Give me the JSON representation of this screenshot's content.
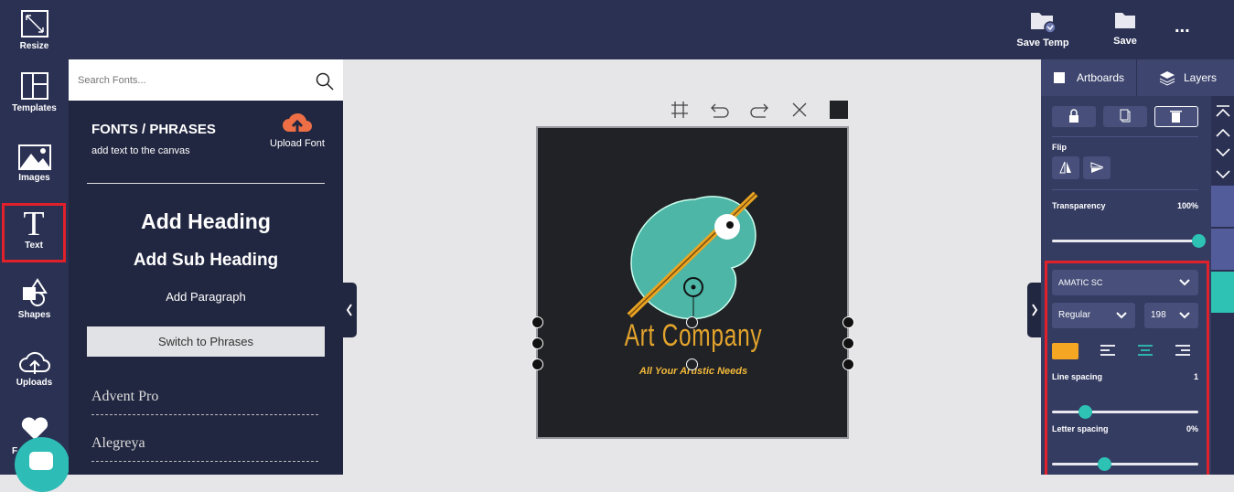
{
  "topbar": {
    "save_temp": "Save Temp",
    "save": "Save",
    "more": "..."
  },
  "sidebar": {
    "items": [
      {
        "label": "Resize",
        "icon": "resize-icon"
      },
      {
        "label": "Templates",
        "icon": "templates-icon"
      },
      {
        "label": "Images",
        "icon": "images-icon"
      },
      {
        "label": "Text",
        "icon": "text-icon",
        "active": true
      },
      {
        "label": "Shapes",
        "icon": "shapes-icon"
      },
      {
        "label": "Uploads",
        "icon": "upload-cloud-icon"
      },
      {
        "label": "F",
        "icon": "heart-icon"
      }
    ]
  },
  "fontpanel": {
    "search_placeholder": "Search Fonts...",
    "title": "FONTS / PHRASES",
    "subtitle": "add text to the canvas",
    "upload_font": "Upload Font",
    "add_heading": "Add Heading",
    "add_subheading": "Add Sub Heading",
    "add_paragraph": "Add Paragraph",
    "switch": "Switch to Phrases",
    "fonts": [
      "Advent Pro",
      "Alegreya"
    ]
  },
  "canvas": {
    "title": "Art Company",
    "tagline": "All Your Artistic Needs",
    "swatch_color": "#212226"
  },
  "rightpanel": {
    "tabs": [
      "Artboards",
      "Layers"
    ],
    "flip_label": "Flip",
    "transparency_label": "Transparency",
    "transparency_value": "100%",
    "transparency": 100,
    "font_family": "Amatic SC",
    "font_weight": "Regular",
    "font_size": "198",
    "text_color": "#f5a623",
    "alignment": "center",
    "line_spacing_label": "Line spacing",
    "line_spacing_value": "1",
    "line_spacing_fraction": 0.23,
    "letter_spacing_label": "Letter spacing",
    "letter_spacing_value": "0%",
    "letter_spacing_fraction": 0.36
  },
  "colors": {
    "accent": "#2dc2b4",
    "highlight": "#e0202a",
    "topbar": "#2b3153",
    "panel": "#222741"
  }
}
